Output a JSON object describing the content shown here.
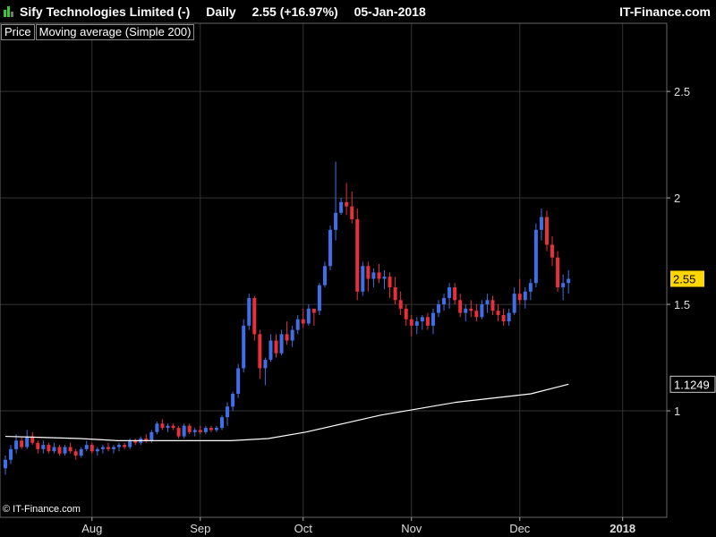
{
  "header": {
    "instrument": "Sify Technologies Limited (-)",
    "period": "Daily",
    "price_change": "2.55 (+16.97%)",
    "date": "05-Jan-2018",
    "brand": "IT-Finance.com"
  },
  "legend": {
    "price_label": "Price",
    "ma_label": "Moving average (Simple 200)"
  },
  "watermark": "© IT-Finance.com",
  "price_tag": {
    "value": "2.55",
    "color": "#FFD700"
  },
  "ma_tag": {
    "value": "1.1249"
  },
  "colors": {
    "up": "#3F6FE8",
    "down": "#E8303A",
    "ma": "#FFFFFF",
    "grid": "#333333",
    "background": "#000000"
  },
  "chart_data": {
    "type": "candlestick",
    "y_ticks": [
      1,
      1.5,
      2,
      2.5
    ],
    "ylim": [
      0.5,
      2.82
    ],
    "x_tick_labels": [
      {
        "label": "Aug",
        "index": 16
      },
      {
        "label": "Sep",
        "index": 36
      },
      {
        "label": "Oct",
        "index": 55
      },
      {
        "label": "Nov",
        "index": 75
      },
      {
        "label": "Dec",
        "index": 95
      },
      {
        "label": "2018",
        "index": 114
      }
    ],
    "candles": [
      [
        0.73,
        0.79,
        0.7,
        0.77
      ],
      [
        0.77,
        0.84,
        0.75,
        0.82
      ],
      [
        0.82,
        0.89,
        0.8,
        0.86
      ],
      [
        0.86,
        0.88,
        0.82,
        0.83
      ],
      [
        0.83,
        0.91,
        0.82,
        0.88
      ],
      [
        0.88,
        0.9,
        0.84,
        0.85
      ],
      [
        0.85,
        0.86,
        0.8,
        0.82
      ],
      [
        0.82,
        0.86,
        0.8,
        0.84
      ],
      [
        0.84,
        0.85,
        0.8,
        0.81
      ],
      [
        0.81,
        0.85,
        0.8,
        0.83
      ],
      [
        0.83,
        0.84,
        0.79,
        0.8
      ],
      [
        0.8,
        0.84,
        0.79,
        0.83
      ],
      [
        0.83,
        0.85,
        0.8,
        0.81
      ],
      [
        0.81,
        0.82,
        0.77,
        0.79
      ],
      [
        0.79,
        0.83,
        0.78,
        0.82
      ],
      [
        0.82,
        0.86,
        0.81,
        0.84
      ],
      [
        0.84,
        0.85,
        0.8,
        0.81
      ],
      [
        0.81,
        0.83,
        0.79,
        0.82
      ],
      [
        0.82,
        0.84,
        0.8,
        0.83
      ],
      [
        0.83,
        0.85,
        0.81,
        0.82
      ],
      [
        0.82,
        0.84,
        0.8,
        0.83
      ],
      [
        0.83,
        0.85,
        0.81,
        0.84
      ],
      [
        0.84,
        0.85,
        0.82,
        0.83
      ],
      [
        0.83,
        0.87,
        0.82,
        0.86
      ],
      [
        0.86,
        0.87,
        0.84,
        0.85
      ],
      [
        0.85,
        0.88,
        0.84,
        0.87
      ],
      [
        0.87,
        0.89,
        0.85,
        0.86
      ],
      [
        0.86,
        0.91,
        0.85,
        0.9
      ],
      [
        0.9,
        0.95,
        0.89,
        0.94
      ],
      [
        0.94,
        0.96,
        0.91,
        0.92
      ],
      [
        0.92,
        0.94,
        0.9,
        0.93
      ],
      [
        0.93,
        0.94,
        0.91,
        0.92
      ],
      [
        0.92,
        0.93,
        0.87,
        0.88
      ],
      [
        0.88,
        0.94,
        0.87,
        0.93
      ],
      [
        0.93,
        0.94,
        0.89,
        0.9
      ],
      [
        0.9,
        0.92,
        0.88,
        0.91
      ],
      [
        0.91,
        0.93,
        0.89,
        0.9
      ],
      [
        0.9,
        0.93,
        0.89,
        0.92
      ],
      [
        0.92,
        0.93,
        0.9,
        0.91
      ],
      [
        0.91,
        0.93,
        0.9,
        0.92
      ],
      [
        0.92,
        0.98,
        0.91,
        0.97
      ],
      [
        0.97,
        1.04,
        0.93,
        1.02
      ],
      [
        1.02,
        1.09,
        1.0,
        1.08
      ],
      [
        1.08,
        1.22,
        1.06,
        1.2
      ],
      [
        1.2,
        1.43,
        1.18,
        1.4
      ],
      [
        1.4,
        1.55,
        1.38,
        1.53
      ],
      [
        1.53,
        1.54,
        1.33,
        1.36
      ],
      [
        1.36,
        1.38,
        1.15,
        1.2
      ],
      [
        1.2,
        1.25,
        1.12,
        1.24
      ],
      [
        1.24,
        1.36,
        1.23,
        1.33
      ],
      [
        1.33,
        1.36,
        1.25,
        1.27
      ],
      [
        1.27,
        1.38,
        1.26,
        1.36
      ],
      [
        1.36,
        1.42,
        1.31,
        1.33
      ],
      [
        1.33,
        1.4,
        1.3,
        1.38
      ],
      [
        1.38,
        1.45,
        1.36,
        1.43
      ],
      [
        1.43,
        1.48,
        1.39,
        1.41
      ],
      [
        1.41,
        1.5,
        1.4,
        1.48
      ],
      [
        1.48,
        1.46,
        1.4,
        1.46
      ],
      [
        1.47,
        1.6,
        1.45,
        1.59
      ],
      [
        1.59,
        1.7,
        1.58,
        1.68
      ],
      [
        1.68,
        1.87,
        1.66,
        1.85
      ],
      [
        1.85,
        2.17,
        1.8,
        1.93
      ],
      [
        1.93,
        2.0,
        1.92,
        1.98
      ],
      [
        1.98,
        2.07,
        1.92,
        1.96
      ],
      [
        1.96,
        2.03,
        1.88,
        1.9
      ],
      [
        1.9,
        1.95,
        1.52,
        1.56
      ],
      [
        1.56,
        1.7,
        1.54,
        1.68
      ],
      [
        1.68,
        1.7,
        1.56,
        1.62
      ],
      [
        1.62,
        1.67,
        1.58,
        1.65
      ],
      [
        1.65,
        1.69,
        1.6,
        1.62
      ],
      [
        1.62,
        1.66,
        1.57,
        1.63
      ],
      [
        1.63,
        1.65,
        1.53,
        1.58
      ],
      [
        1.58,
        1.63,
        1.5,
        1.52
      ],
      [
        1.52,
        1.56,
        1.45,
        1.48
      ],
      [
        1.48,
        1.5,
        1.4,
        1.43
      ],
      [
        1.43,
        1.45,
        1.35,
        1.4
      ],
      [
        1.4,
        1.44,
        1.36,
        1.42
      ],
      [
        1.42,
        1.45,
        1.38,
        1.44
      ],
      [
        1.44,
        1.46,
        1.38,
        1.4
      ],
      [
        1.4,
        1.48,
        1.36,
        1.46
      ],
      [
        1.46,
        1.52,
        1.44,
        1.5
      ],
      [
        1.5,
        1.55,
        1.47,
        1.53
      ],
      [
        1.53,
        1.6,
        1.48,
        1.58
      ],
      [
        1.58,
        1.6,
        1.5,
        1.52
      ],
      [
        1.52,
        1.55,
        1.44,
        1.46
      ],
      [
        1.46,
        1.5,
        1.42,
        1.48
      ],
      [
        1.48,
        1.52,
        1.44,
        1.47
      ],
      [
        1.47,
        1.5,
        1.42,
        1.44
      ],
      [
        1.44,
        1.52,
        1.43,
        1.5
      ],
      [
        1.5,
        1.55,
        1.46,
        1.52
      ],
      [
        1.52,
        1.54,
        1.45,
        1.47
      ],
      [
        1.47,
        1.5,
        1.42,
        1.45
      ],
      [
        1.45,
        1.48,
        1.4,
        1.42
      ],
      [
        1.42,
        1.48,
        1.4,
        1.46
      ],
      [
        1.46,
        1.58,
        1.45,
        1.55
      ],
      [
        1.55,
        1.62,
        1.5,
        1.52
      ],
      [
        1.52,
        1.58,
        1.48,
        1.56
      ],
      [
        1.56,
        1.62,
        1.52,
        1.6
      ],
      [
        1.6,
        1.88,
        1.58,
        1.85
      ],
      [
        1.85,
        1.95,
        1.8,
        1.91
      ],
      [
        1.91,
        1.94,
        1.75,
        1.78
      ],
      [
        1.78,
        1.82,
        1.68,
        1.72
      ],
      [
        1.72,
        1.75,
        1.56,
        1.58
      ],
      [
        1.58,
        1.64,
        1.52,
        1.6
      ],
      [
        1.6,
        1.66,
        1.55,
        1.62
      ]
    ],
    "ma_values": [
      0.88,
      0.875,
      0.87,
      0.86,
      0.86,
      0.86,
      0.86,
      0.87,
      0.9,
      0.94,
      0.98,
      1.01,
      1.04,
      1.06,
      1.08,
      1.1249
    ]
  }
}
